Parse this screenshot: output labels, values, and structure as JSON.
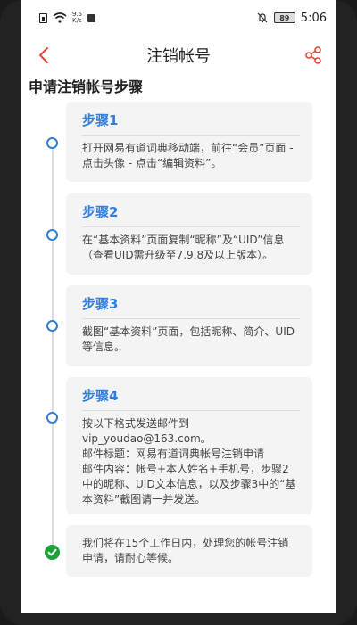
{
  "status_bar": {
    "speed_value": "9.5",
    "speed_unit": "K/s",
    "battery": "89",
    "time": "5:06"
  },
  "header": {
    "title": "注销帐号"
  },
  "section": {
    "title": "申请注销帐号步骤"
  },
  "steps": [
    {
      "title": "步骤1",
      "body": "打开网易有道词典移动端，前往“会员”页面 -\n点击头像 - 点击“编辑资料”。"
    },
    {
      "title": "步骤2",
      "body": "在“基本资料”页面复制“昵称”及“UID”信息\n（查看UID需升级至7.9.8及以上版本）。"
    },
    {
      "title": "步骤3",
      "body": "截图“基本资料”页面，包括昵称、简介、UID\n等信息。"
    },
    {
      "title": "步骤4",
      "body": "按以下格式发送邮件到\nvip_youdao@163.com。\n邮件标题：网易有道词典帐号注销申请\n邮件内容：帐号+本人姓名+手机号，步骤2\n中的昵称、UID文本信息，以及步骤3中的“基\n本资料”截图请一并发送。"
    }
  ],
  "final": {
    "text": "我们将在15个工作日内，处理您的帐号注销\n申请，请耐心等候。"
  },
  "colors": {
    "accent_red": "#e0463a",
    "step_blue": "#2f7fe0",
    "check_green": "#1ba13c"
  }
}
